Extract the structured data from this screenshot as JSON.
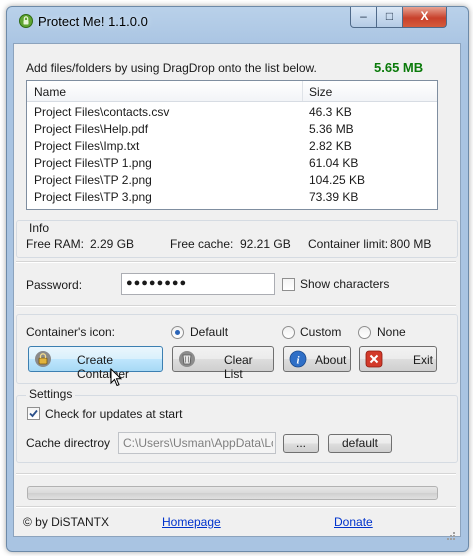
{
  "window": {
    "title": "Protect Me! 1.1.0.0",
    "caption_buttons": {
      "minimize": "–",
      "maximize": "□",
      "close": "X"
    }
  },
  "files": {
    "instruction": "Add files/folders by using DragDrop onto the list below.",
    "total_size": "5.65 MB",
    "total_color": "#0a7a0a",
    "columns": [
      "Name",
      "Size"
    ],
    "rows": [
      {
        "name": "Project Files\\contacts.csv",
        "size": "46.3 KB"
      },
      {
        "name": "Project Files\\Help.pdf",
        "size": "5.36 MB"
      },
      {
        "name": "Project Files\\Imp.txt",
        "size": "2.82 KB"
      },
      {
        "name": "Project Files\\TP 1.png",
        "size": "61.04 KB"
      },
      {
        "name": "Project Files\\TP 2.png",
        "size": "104.25 KB"
      },
      {
        "name": "Project Files\\TP 3.png",
        "size": "73.39 KB"
      }
    ]
  },
  "info": {
    "section_label": "Info",
    "free_ram_label": "Free RAM:",
    "free_ram_value": "2.29 GB",
    "free_cache_label": "Free cache:",
    "free_cache_value": "92.21 GB",
    "container_limit_label": "Container limit:",
    "container_limit_value": "800 MB"
  },
  "password": {
    "label": "Password:",
    "value": "●●●●●●●●",
    "show_characters_label": "Show characters",
    "show_characters_checked": false
  },
  "icon": {
    "label": "Container's icon:",
    "options": [
      "Default",
      "Custom",
      "None"
    ],
    "selected": "Default"
  },
  "actions": {
    "create": "Create Container",
    "clear": "Clear List",
    "about": "About",
    "exit": "Exit"
  },
  "settings": {
    "section_label": "Settings",
    "check_updates_label": "Check for updates at start",
    "check_updates_checked": true,
    "cache_dir_label": "Cache directroy",
    "cache_dir_value": "C:\\Users\\Usman\\AppData\\Loc",
    "browse_label": "...",
    "default_label": "default"
  },
  "footer": {
    "copyright": "© by DiSTANTX",
    "homepage": "Homepage",
    "donate": "Donate"
  }
}
